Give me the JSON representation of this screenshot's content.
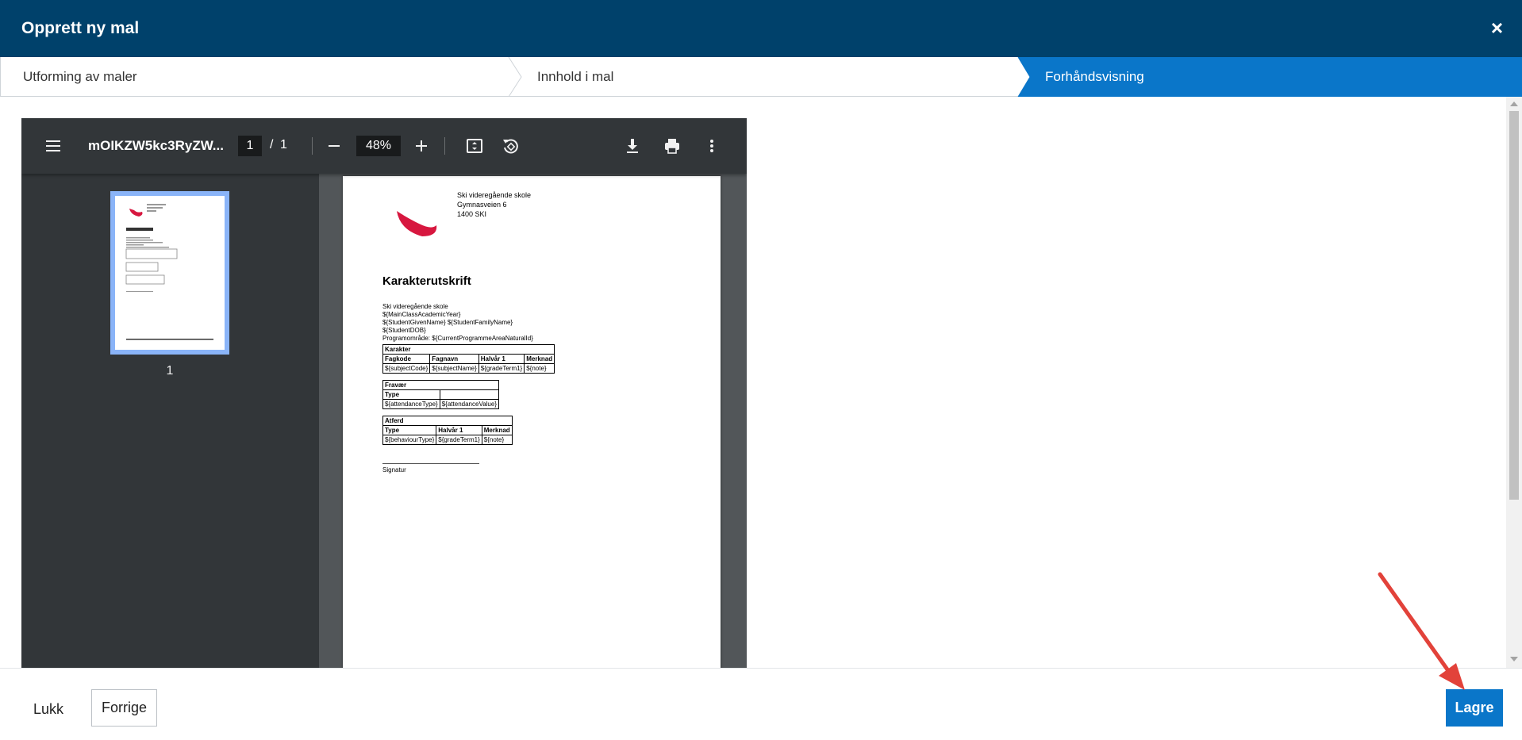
{
  "dialog": {
    "title": "Opprett ny mal",
    "close_glyph": "×"
  },
  "steps": [
    {
      "label": "Utforming av maler",
      "active": false
    },
    {
      "label": "Innhold i mal",
      "active": false
    },
    {
      "label": "Forhåndsvisning",
      "active": true
    }
  ],
  "pdf_viewer": {
    "filename": "mOIKZW5kc3RyZW...",
    "current_page": "1",
    "page_separator": "/",
    "total_pages": "1",
    "zoom": "48%",
    "thumbnail_label": "1",
    "icons": [
      "menu-icon",
      "zoom-out-icon",
      "zoom-in-icon",
      "fit-page-icon",
      "rotate-icon",
      "download-icon",
      "print-icon",
      "more-vert-icon"
    ]
  },
  "document": {
    "school_name": "Ski videregående skole",
    "street": "Gymnasveien 6",
    "postal": "1400 SKI",
    "title": "Karakterutskrift",
    "info_lines": [
      "Ski videregående skole",
      "${MainClassAcademicYear}",
      "${StudentGivenName} ${StudentFamilyName}",
      "${StudentDOB}",
      "Programområde: ${CurrentProgrammeAreaNaturalId}"
    ],
    "grades_table": {
      "caption": "Karakter",
      "headers": [
        "Fagkode",
        "Fagnavn",
        "Halvår 1",
        "Merknad"
      ],
      "row": [
        "${subjectCode}",
        "${subjectName}",
        "${gradeTerm1}",
        "${note}"
      ]
    },
    "absence_table": {
      "caption": "Fravær",
      "headers": [
        "Type",
        ""
      ],
      "row": [
        "${attendanceType}",
        "${attendanceValue}"
      ]
    },
    "behaviour_table": {
      "caption": "Atferd",
      "headers": [
        "Type",
        "Halvår 1",
        "Merknad"
      ],
      "row": [
        "${behaviourType}",
        "${gradeTerm1}",
        "${note}"
      ]
    },
    "signature_label": "Signatur"
  },
  "footer": {
    "close_label": "Lukk",
    "previous_label": "Forrige",
    "save_label": "Lagre"
  },
  "colors": {
    "header": "#00416b",
    "active_step": "#0a76c9",
    "primary_button": "#0a76c9",
    "annotation_arrow": "#e2423a",
    "logo": "#d7173f"
  }
}
